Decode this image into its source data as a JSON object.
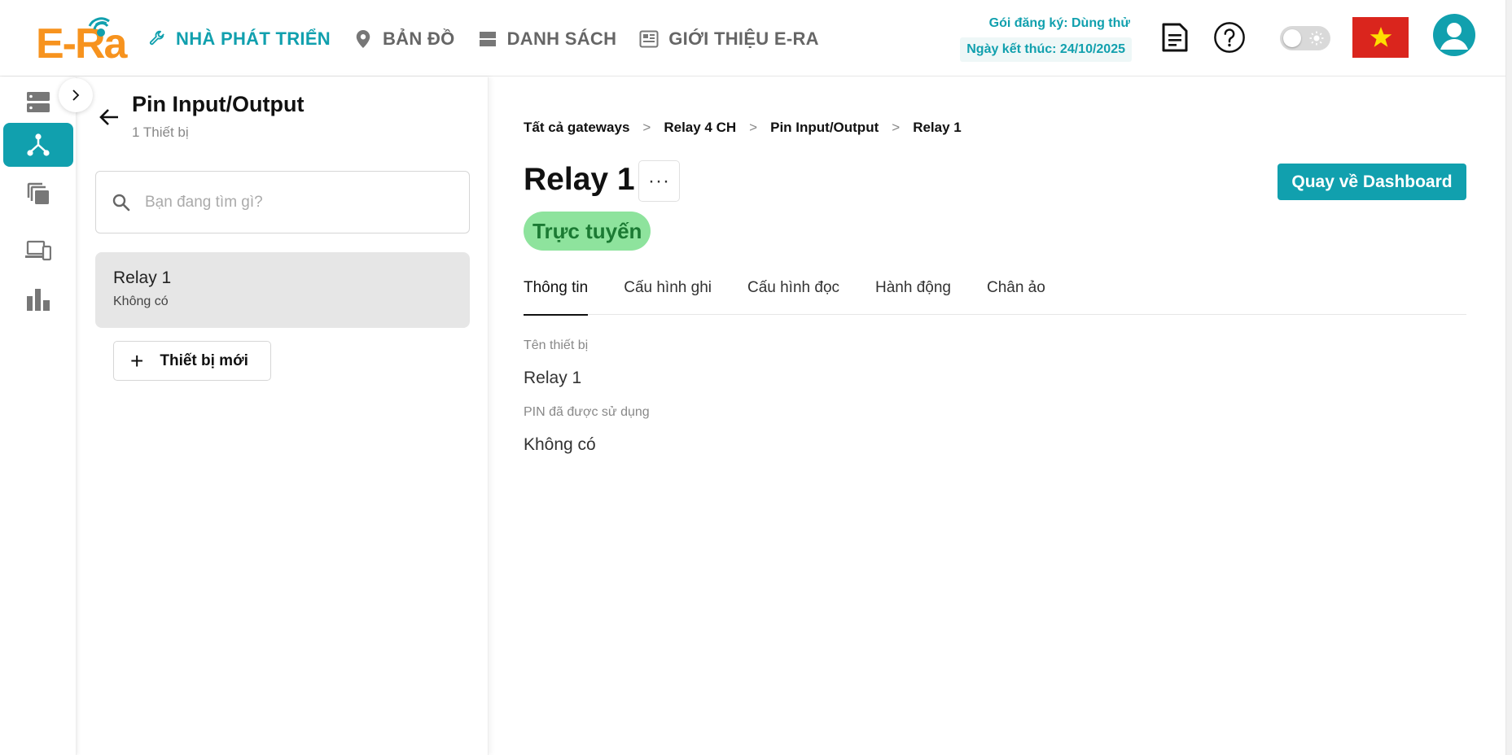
{
  "app": {
    "logo_text": "E-Ra"
  },
  "nav": {
    "items": [
      {
        "label": "NHÀ PHÁT TRIỂN",
        "icon": "wrench-icon",
        "active": true
      },
      {
        "label": "BẢN ĐỒ",
        "icon": "map-pin-icon",
        "active": false
      },
      {
        "label": "DANH SÁCH",
        "icon": "list-icon",
        "active": false
      },
      {
        "label": "GIỚI THIỆU E-RA",
        "icon": "newspaper-icon",
        "active": false
      }
    ]
  },
  "subscription": {
    "plan": "Gói đăng ký: Dùng thử",
    "end_date": "Ngày kết thúc: 24/10/2025"
  },
  "header_icons": [
    "document-icon",
    "help-icon",
    "theme-toggle",
    "vietnam-flag-icon",
    "user-avatar-icon"
  ],
  "colors": {
    "accent": "#11a0ae",
    "logo_orange": "#f7931e",
    "status_bg": "#8ee39d",
    "status_text": "#1b7a33",
    "flag_red": "#da251d",
    "flag_star": "#ffde00"
  },
  "rail": {
    "items": [
      {
        "icon": "server-icon",
        "active": false
      },
      {
        "icon": "network-icon",
        "active": true
      },
      {
        "icon": "copy-icon",
        "active": false
      },
      {
        "icon": "devices-icon",
        "active": false
      },
      {
        "icon": "bar-chart-icon",
        "active": false
      }
    ]
  },
  "panel": {
    "title": "Pin Input/Output",
    "count": "1 Thiết bị",
    "search_placeholder": "Bạn đang tìm gì?",
    "devices": [
      {
        "name": "Relay 1",
        "sub": "Không có"
      }
    ],
    "new_device_label": "Thiết bị mới"
  },
  "breadcrumb": [
    "Tất cả gateways",
    "Relay 4 CH",
    "Pin Input/Output",
    "Relay 1"
  ],
  "breadcrumb_separator": ">",
  "device": {
    "title": "Relay 1",
    "more_label": "···",
    "status": "Trực tuyến",
    "dashboard_button": "Quay về Dashboard"
  },
  "tabs": [
    {
      "label": "Thông tin",
      "active": true
    },
    {
      "label": "Cấu hình ghi",
      "active": false
    },
    {
      "label": "Cấu hình đọc",
      "active": false
    },
    {
      "label": "Hành động",
      "active": false
    },
    {
      "label": "Chân ảo",
      "active": false
    }
  ],
  "fields": [
    {
      "label": "Tên thiết bị",
      "value": "Relay 1"
    },
    {
      "label": "PIN đã được sử dụng",
      "value": "Không có"
    }
  ]
}
